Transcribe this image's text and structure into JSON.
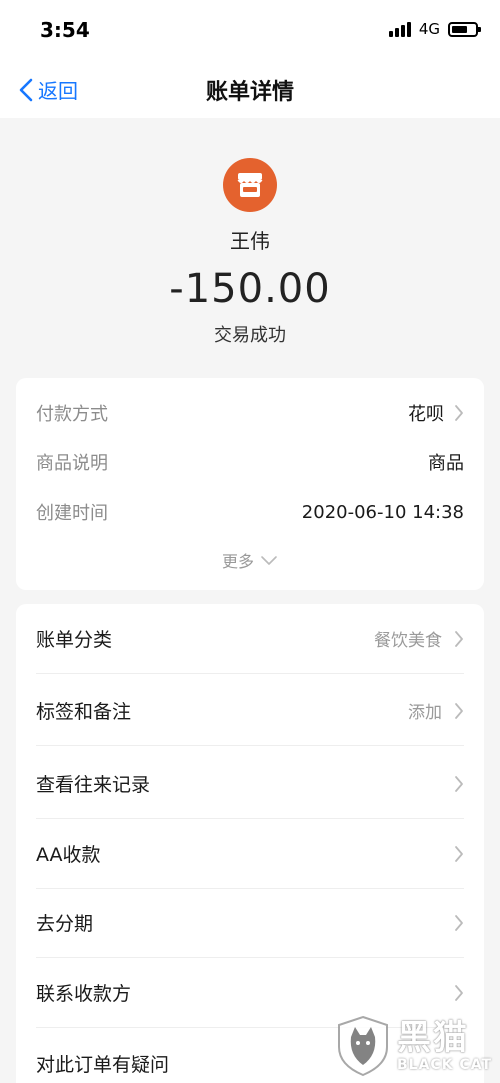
{
  "status_bar": {
    "time": "3:54",
    "network": "4G",
    "battery_level": 0.7
  },
  "nav": {
    "back_label": "返回",
    "title": "账单详情"
  },
  "hero": {
    "merchant_name": "王伟",
    "amount": "-150.00",
    "status": "交易成功",
    "avatar_color": "#e4622e"
  },
  "details": {
    "payment_method": {
      "label": "付款方式",
      "value": "花呗"
    },
    "product_desc": {
      "label": "商品说明",
      "value": "商品"
    },
    "created_time": {
      "label": "创建时间",
      "value": "2020-06-10 14:38"
    },
    "more_label": "更多"
  },
  "actions": {
    "category": {
      "label": "账单分类",
      "value": "餐饮美食"
    },
    "tags": {
      "label": "标签和备注",
      "value": "添加"
    },
    "history": {
      "label": "查看往来记录"
    },
    "aa": {
      "label": "AA收款"
    },
    "installment": {
      "label": "去分期"
    },
    "contact": {
      "label": "联系收款方"
    },
    "question": {
      "label": "对此订单有疑问"
    }
  },
  "watermark": {
    "cn": "黑猫",
    "en": "BLACK CAT"
  },
  "colors": {
    "accent": "#1677ff",
    "background": "#f5f5f5"
  }
}
